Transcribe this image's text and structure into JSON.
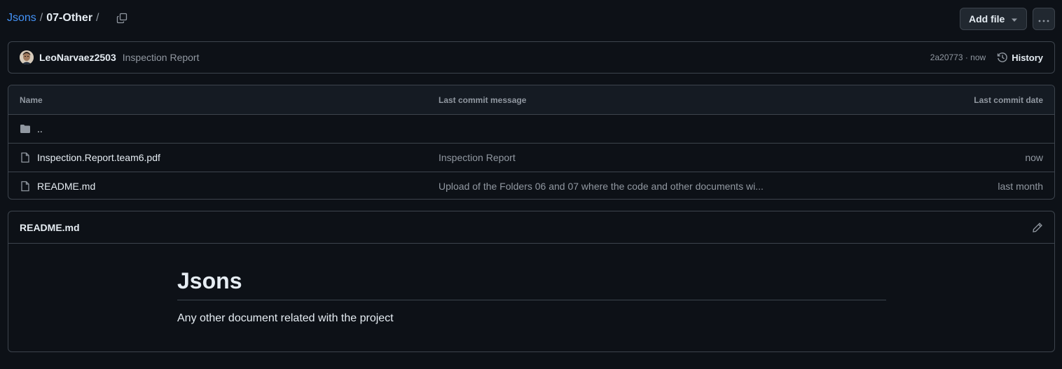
{
  "breadcrumb": {
    "repo": "Jsons",
    "sep": "/",
    "folder": "07-Other",
    "trailing_sep": "/"
  },
  "actions": {
    "add_file": "Add file",
    "more": "···"
  },
  "commit": {
    "author": "LeoNarvaez2503",
    "message": "Inspection Report",
    "hash_time": "2a20773 · now",
    "history": "History"
  },
  "table": {
    "headers": [
      "Name",
      "Last commit message",
      "Last commit date"
    ],
    "rows": [
      {
        "name": "..",
        "icon": "folder-icon",
        "message": "",
        "date": ""
      },
      {
        "name": "Inspection.Report.team6.pdf",
        "icon": "file-icon",
        "message": "Inspection Report",
        "date": "now"
      },
      {
        "name": "README.md",
        "icon": "file-icon",
        "message": "Upload of the Folders 06 and 07 where the code and other documents wi...",
        "date": "last month"
      }
    ]
  },
  "readme": {
    "title": "README.md",
    "heading": "Jsons",
    "paragraph": "Any other document related with the project"
  },
  "colors": {
    "accent": "#4493f8",
    "background": "#0d1117",
    "border": "#3d444d",
    "muted": "#9198a1"
  }
}
